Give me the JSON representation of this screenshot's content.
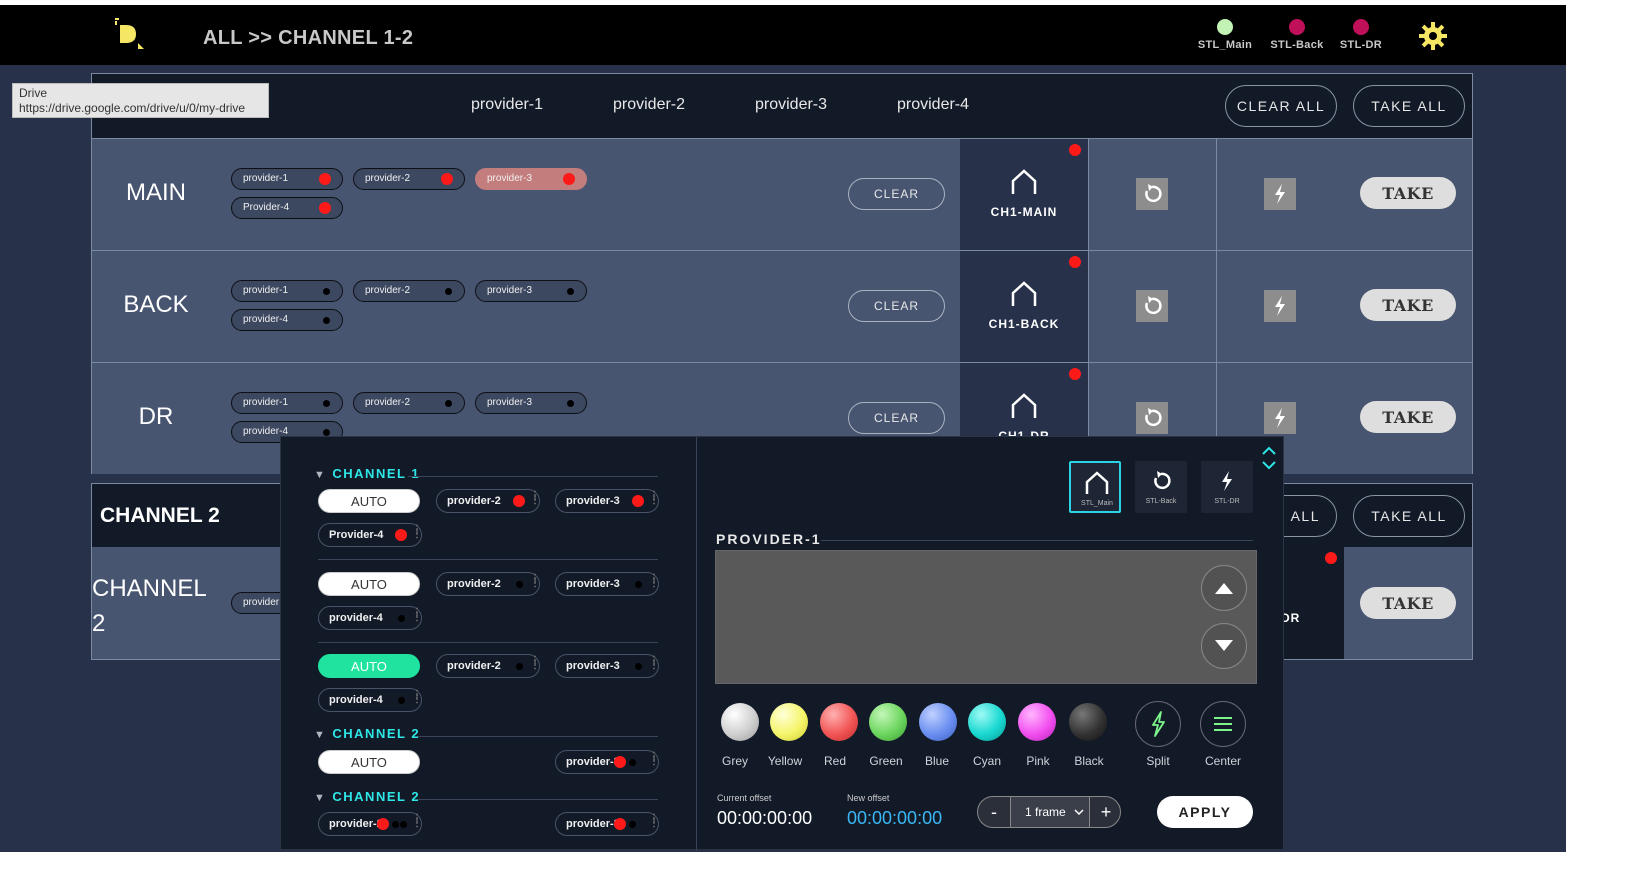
{
  "header": {
    "breadcrumb": "ALL >> CHANNEL 1-2",
    "status": [
      {
        "label": "STL_Main",
        "color": "#c3f3b4"
      },
      {
        "label": "STL-Back",
        "color": "#c0105a"
      },
      {
        "label": "STL-DR",
        "color": "#c0105a"
      }
    ],
    "settings_icon": "gear-icon",
    "logo_color": "#f5e663"
  },
  "tooltip": {
    "title": "Drive",
    "url": "https://drive.google.com/drive/u/0/my-drive"
  },
  "channel1": {
    "providers": [
      "provider-1",
      "provider-2",
      "provider-3",
      "provider-4"
    ],
    "clear_all": "CLEAR ALL",
    "take_all": "TAKE ALL",
    "rows": [
      {
        "name": "MAIN",
        "pills": [
          {
            "label": "provider-1",
            "active": true
          },
          {
            "label": "provider-2",
            "active": true
          },
          {
            "label": "provider-3",
            "active": true
          },
          {
            "label": "Provider-4",
            "active": true
          }
        ],
        "clear": "CLEAR",
        "output": "CH1-MAIN",
        "take": "TAKE"
      },
      {
        "name": "BACK",
        "pills": [
          {
            "label": "provider-1",
            "active": false
          },
          {
            "label": "provider-2",
            "active": false
          },
          {
            "label": "provider-3",
            "active": false
          },
          {
            "label": "provider-4",
            "active": false
          }
        ],
        "clear": "CLEAR",
        "output": "CH1-BACK",
        "take": "TAKE"
      },
      {
        "name": "DR",
        "pills": [
          {
            "label": "provider-1",
            "active": false
          },
          {
            "label": "provider-2",
            "active": false
          },
          {
            "label": "provider-3",
            "active": false
          },
          {
            "label": "provider-4",
            "active": false
          }
        ],
        "clear": "CLEAR",
        "output": "CH1-DR",
        "take": "TAKE"
      }
    ]
  },
  "channel2": {
    "title": "CHANNEL 2",
    "clear_all_partial": "R ALL",
    "take_all": "TAKE ALL",
    "row_name": "CHANNEL 2",
    "pill_partial": "provider",
    "output_partial": "-DR",
    "take": "TAKE"
  },
  "popup": {
    "sections": [
      {
        "title": "CHANNEL 1",
        "groups": [
          {
            "auto": "AUTO",
            "auto_on": false,
            "pills": [
              "provider-2",
              "provider-3",
              "Provider-4"
            ]
          },
          {
            "auto": "AUTO",
            "auto_on": false,
            "pills": [
              "provider-2",
              "provider-3",
              "provider-4"
            ]
          },
          {
            "auto": "AUTO",
            "auto_on": true,
            "pills": [
              "provider-2",
              "provider-3",
              "provider-4"
            ]
          }
        ]
      },
      {
        "title": "CHANNEL 2",
        "groups": [
          {
            "auto": "AUTO",
            "auto_on": false,
            "pills": [
              "provider-3"
            ]
          }
        ]
      },
      {
        "title": "CHANNEL 2",
        "groups": [
          {
            "pills": [
              "provider-2",
              "provider-3"
            ]
          }
        ]
      }
    ],
    "targets": [
      {
        "label": "STL_Main",
        "icon": "home-icon",
        "selected": true
      },
      {
        "label": "STL-Back",
        "icon": "refresh-icon",
        "selected": false
      },
      {
        "label": "STL-DR",
        "icon": "bolt-icon",
        "selected": false
      }
    ],
    "provider_title": "PROVIDER-1",
    "colors": [
      {
        "name": "Grey",
        "hex": "#e8e8e8"
      },
      {
        "name": "Yellow",
        "hex": "#f5f56b"
      },
      {
        "name": "Red",
        "hex": "#f25555"
      },
      {
        "name": "Green",
        "hex": "#6cd65e"
      },
      {
        "name": "Blue",
        "hex": "#6a8ff0"
      },
      {
        "name": "Cyan",
        "hex": "#18d8d0"
      },
      {
        "name": "Pink",
        "hex": "#f24ff0"
      },
      {
        "name": "Black",
        "hex": "#333333"
      }
    ],
    "split": "Split",
    "center": "Center",
    "current_offset_label": "Current offset",
    "current_offset": "00:00:00:00",
    "new_offset_label": "New offset",
    "new_offset": "00:00:00:00",
    "step_value": "1 frame",
    "minus": "-",
    "plus": "+",
    "apply": "APPLY"
  }
}
